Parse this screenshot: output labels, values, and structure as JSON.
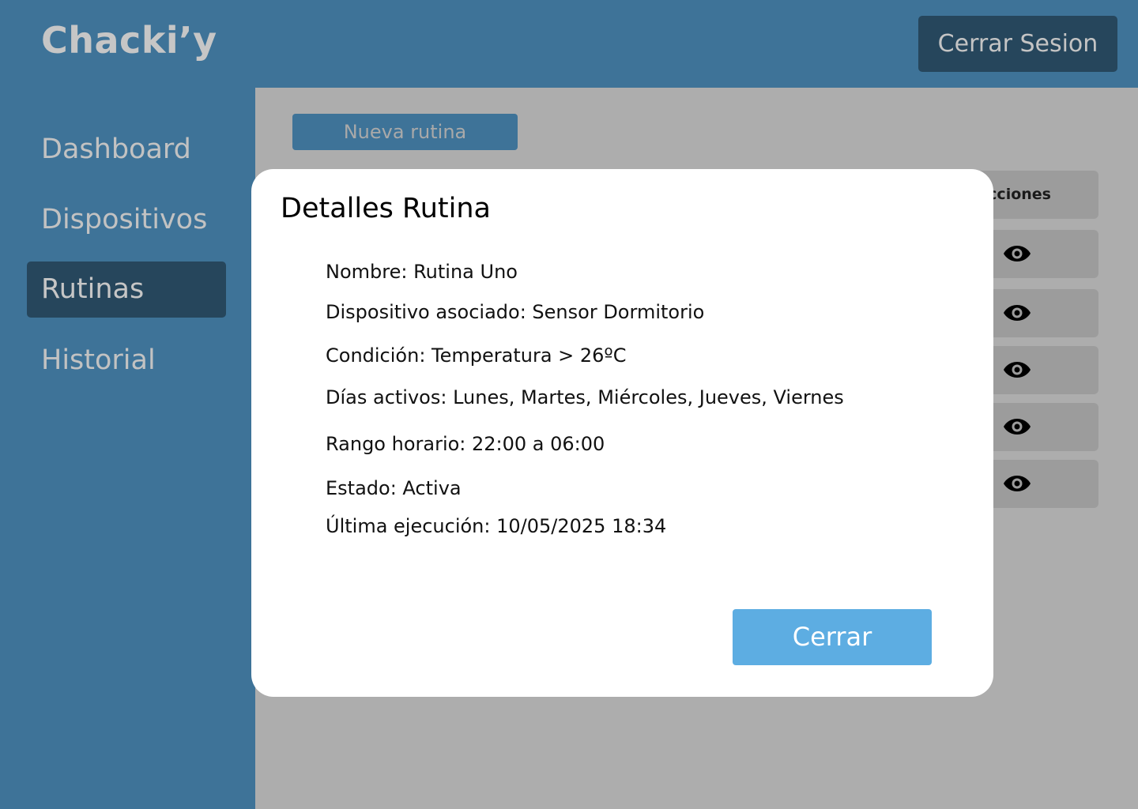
{
  "app": {
    "brand": "Chacki’y"
  },
  "header": {
    "logout_label": "Cerrar Sesion"
  },
  "sidebar": {
    "items": [
      {
        "label": "Dashboard",
        "active": false
      },
      {
        "label": "Dispositivos",
        "active": false
      },
      {
        "label": "Rutinas",
        "active": true
      },
      {
        "label": "Historial",
        "active": false
      }
    ]
  },
  "main": {
    "new_routine_label": "Nueva rutina",
    "table": {
      "actions_header": "cciones",
      "row_icon": "eye-icon",
      "row_count": 5
    }
  },
  "modal": {
    "title": "Detalles Rutina",
    "details": [
      "Nombre: Rutina Uno",
      "Dispositivo asociado: Sensor Dormitorio",
      "Condición: Temperatura > 26ºC",
      "Días activos: Lunes, Martes, Miércoles, Jueves, Viernes",
      "Rango horario: 22:00 a 06:00",
      "Estado: Activa",
      "Última ejecución: 10/05/2025 18:34"
    ],
    "close_label": "Cerrar"
  },
  "colors": {
    "primary": "#3e7398",
    "dark": "#26465c",
    "overlay": "#adadad",
    "accent": "#5dade2",
    "modal_bg": "#ffffff"
  }
}
